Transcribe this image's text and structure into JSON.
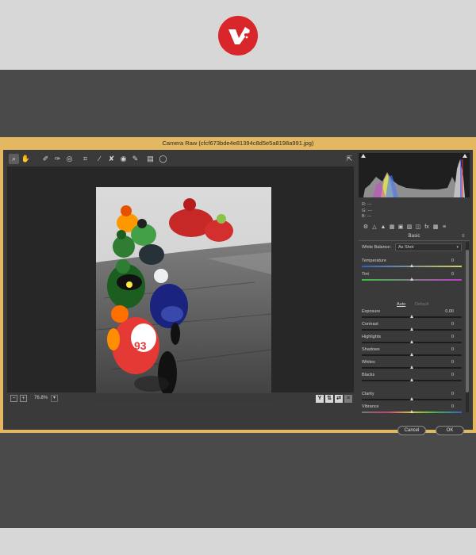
{
  "window": {
    "title": "Camera Raw (cfcf673bde4e81394c8d5e5a8198a991.jpg)"
  },
  "toolbar": {
    "tools": [
      {
        "name": "zoom-tool-icon",
        "glyph": "⌕",
        "active": true
      },
      {
        "name": "hand-tool-icon",
        "glyph": "✋"
      },
      {
        "name": "white-balance-tool-icon",
        "glyph": "✐"
      },
      {
        "name": "color-sampler-tool-icon",
        "glyph": "✑"
      },
      {
        "name": "targeted-adjustment-tool-icon",
        "glyph": "◎"
      },
      {
        "name": "crop-tool-icon",
        "glyph": "⌗"
      },
      {
        "name": "straighten-tool-icon",
        "glyph": "∕"
      },
      {
        "name": "spot-removal-tool-icon",
        "glyph": "✘"
      },
      {
        "name": "red-eye-tool-icon",
        "glyph": "◉"
      },
      {
        "name": "adjustment-brush-icon",
        "glyph": "✎"
      },
      {
        "name": "graduated-filter-icon",
        "glyph": "▤"
      },
      {
        "name": "radial-filter-icon",
        "glyph": "◯"
      }
    ],
    "export_glyph": "⇱"
  },
  "status": {
    "zoom": "76.8%"
  },
  "readout": {
    "r": "R:  ---",
    "g": "G:  ---",
    "b": "B:  ---"
  },
  "panel": {
    "tabs": [
      "⚙",
      "△",
      "▲",
      "▦",
      "▣",
      "▨",
      "◫",
      "fx",
      "▩",
      "≡"
    ],
    "name": "Basic",
    "menu": "≡"
  },
  "white_balance": {
    "label": "White Balance:",
    "value": "As Shot"
  },
  "sliders_top": [
    {
      "name": "temperature",
      "label": "Temperature",
      "value": "0",
      "level": 0.5,
      "gradient": "linear-gradient(to right,#2d5fd3,#d7d052)"
    },
    {
      "name": "tint",
      "label": "Tint",
      "value": "0",
      "level": 0.5,
      "gradient": "linear-gradient(to right,#3dbf44,#c23ac8)"
    }
  ],
  "links": {
    "auto": "Auto",
    "default": "Default"
  },
  "sliders_tone": [
    {
      "name": "exposure",
      "label": "Exposure",
      "value": "0.00",
      "level": 0.5
    },
    {
      "name": "contrast",
      "label": "Contrast",
      "value": "0",
      "level": 0.5
    },
    {
      "name": "highlights",
      "label": "Highlights",
      "value": "0",
      "level": 0.5
    },
    {
      "name": "shadows",
      "label": "Shadows",
      "value": "0",
      "level": 0.5
    },
    {
      "name": "whites",
      "label": "Whites",
      "value": "0",
      "level": 0.5
    },
    {
      "name": "blacks",
      "label": "Blacks",
      "value": "0",
      "level": 0.5
    }
  ],
  "sliders_presence": [
    {
      "name": "clarity",
      "label": "Clarity",
      "value": "0",
      "level": 0.5
    },
    {
      "name": "vibrance",
      "label": "Vibrance",
      "value": "0",
      "level": 0.5,
      "gradient": "linear-gradient(to right,#777,#c0407a,#d0c040,#40b050,#4060c0)"
    }
  ],
  "buttons": {
    "cancel": "Cancel",
    "ok": "OK"
  },
  "colors": {
    "frame": "#e4b861",
    "window_bg": "#3a3a3a",
    "canvas_bg": "#272727",
    "logo": "#d9262a"
  }
}
